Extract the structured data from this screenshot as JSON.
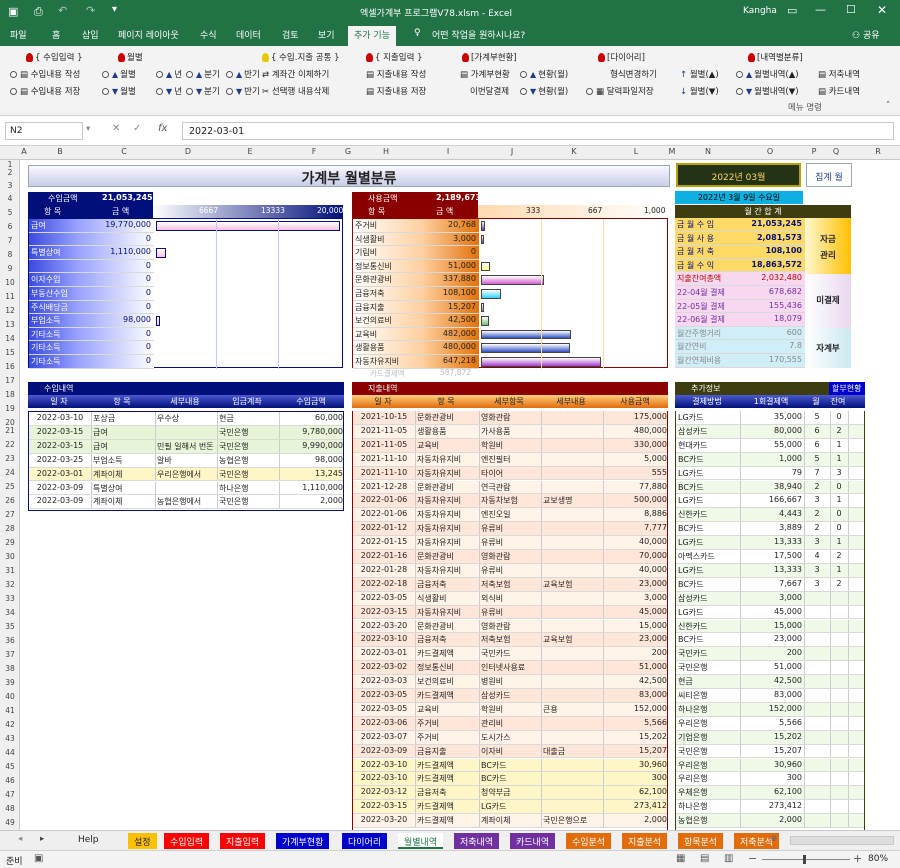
{
  "window": {
    "title": "엑셀가계부 프로그램V78.xlsm  -  Excel",
    "user": "Kangha"
  },
  "ribbon_tabs": [
    "파일",
    "홈",
    "삽입",
    "페이지 레이아웃",
    "수식",
    "데이터",
    "검토",
    "보기",
    "추가 기능"
  ],
  "tell_me": "어떤 작업을 원하시나요?",
  "share": "공유",
  "ribbon": {
    "g1_title": "{ 수입입력 }",
    "g1_a": "수입내용 작성",
    "g1_b": "수입내용 저장",
    "g2_title": "월별",
    "g2_items": [
      "월별",
      "년",
      "분기",
      "반기",
      "월별",
      "년",
      "분기",
      "반기"
    ],
    "g3_title": "{ 수입.지출 공통 }",
    "g3_a": "계좌간 이체하기",
    "g3_b": "선택행 내용삭제",
    "g4_title": "{ 지출입력 }",
    "g4_a": "지출내용 작성",
    "g4_b": "지출내용 저장",
    "g5_title": "[가계부현황]",
    "g5_a": "가계부현황",
    "g5_b": "이번달결제",
    "g5_c": "현황(월)",
    "g5_d": "현황(월)",
    "g6_title": "[다이어리]",
    "g6_a": "형식변경하기",
    "g6_b": "달력파일저장",
    "g7_title": "[내역별분류]",
    "g7_a": "월별(▲)",
    "g7_b": "월별(▼)",
    "g7_c": "월별내역(▲)",
    "g7_d": "월별내역(▼)",
    "g8_a": "저축내역",
    "g8_b": "카드내역",
    "menu_label": "메뉴 명령"
  },
  "formula": {
    "namebox": "N2",
    "value": "2022-03-01"
  },
  "columns": [
    "A",
    "B",
    "C",
    "D",
    "E",
    "F",
    "G",
    "H",
    "I",
    "J",
    "K",
    "L",
    "M",
    "N",
    "O",
    "P",
    "Q",
    "R"
  ],
  "rows": [
    "1",
    "2",
    "3",
    "4",
    "5",
    "6",
    "7",
    "8",
    "9",
    "10",
    "11",
    "12",
    "13",
    "14",
    "15",
    "16",
    "17",
    "18",
    "19",
    "20",
    "21",
    "22",
    "23",
    "24",
    "25",
    "26",
    "27",
    "28",
    "29",
    "30",
    "31",
    "32",
    "33",
    "34",
    "35",
    "36",
    "37",
    "38",
    "39",
    "40",
    "41",
    "42",
    "43",
    "44",
    "45",
    "46",
    "47",
    "48",
    "49",
    "50"
  ],
  "title": "가계부 월별분류",
  "month_box": "2022년 03월",
  "sum_button": "집계 월",
  "today": "2022년 3월 9일 수요일",
  "income": {
    "label": "수입금액",
    "total": "21,053,245",
    "col_item": "항 목",
    "col_amt": "금 액",
    "scale": [
      "6667",
      "13333",
      "20,000"
    ],
    "rows": [
      {
        "name": "급여",
        "amt": "19,770,000",
        "frac": 0.989
      },
      {
        "name": "",
        "amt": "0",
        "frac": 0
      },
      {
        "name": "특별상여",
        "amt": "1,110,000",
        "frac": 0.056
      },
      {
        "name": "",
        "amt": "0",
        "frac": 0
      },
      {
        "name": "이자수입",
        "amt": "0",
        "frac": 0
      },
      {
        "name": "부동산수입",
        "amt": "0",
        "frac": 0
      },
      {
        "name": "주식배당금",
        "amt": "0",
        "frac": 0
      },
      {
        "name": "부업소득",
        "amt": "98,000",
        "frac": 0.005
      },
      {
        "name": "기타소득",
        "amt": "0",
        "frac": 0
      },
      {
        "name": "기타소득",
        "amt": "0",
        "frac": 0
      },
      {
        "name": "기타소득",
        "amt": "0",
        "frac": 0
      }
    ]
  },
  "expense": {
    "label": "사용금액",
    "total": "2,189,673",
    "col_item": "항 목",
    "col_amt": "금 액",
    "scale": [
      "333",
      "667",
      "1,000"
    ],
    "rows": [
      {
        "name": "주거비",
        "amt": "20,768",
        "frac": 0.021
      },
      {
        "name": "식생활비",
        "amt": "3,000",
        "frac": 0.003
      },
      {
        "name": "기림비",
        "amt": "0",
        "frac": 0
      },
      {
        "name": "정보통신비",
        "amt": "51,000",
        "frac": 0.051
      },
      {
        "name": "문화관광비",
        "amt": "337,880",
        "frac": 0.338
      },
      {
        "name": "금융저축",
        "amt": "108,100",
        "frac": 0.108
      },
      {
        "name": "금융지출",
        "amt": "15,207",
        "frac": 0.015
      },
      {
        "name": "보건의료비",
        "amt": "42,500",
        "frac": 0.043
      },
      {
        "name": "교육비",
        "amt": "482,000",
        "frac": 0.482
      },
      {
        "name": "생활용품",
        "amt": "480,000",
        "frac": 0.48
      },
      {
        "name": "자동차유지비",
        "amt": "647,218",
        "frac": 0.647
      }
    ],
    "card_row": {
      "name": "카드결제액",
      "amt": "587,872"
    }
  },
  "monthly": {
    "title": "월 간 합 계",
    "rows": [
      {
        "k": "금 월 수 입",
        "v": "21,053,245"
      },
      {
        "k": "금 월 사 용",
        "v": "2,081,573"
      },
      {
        "k": "금 월 저 축",
        "v": "108,100"
      },
      {
        "k": "금 월 수 익",
        "v": "18,863,572"
      },
      {
        "k": "지출잔여총액",
        "v": "2,032,480"
      },
      {
        "k": "22-04월 결제",
        "v": "678,682"
      },
      {
        "k": "22-05월 결제",
        "v": "155,436"
      },
      {
        "k": "22-06월 결제",
        "v": "18,079"
      },
      {
        "k": "월간주행거리",
        "v": "600"
      },
      {
        "k": "월간연비",
        "v": "7.8"
      },
      {
        "k": "월간연체비용",
        "v": "170,555"
      }
    ],
    "side": [
      "자금",
      "관리",
      "미결제",
      "자계부"
    ]
  },
  "income_list": {
    "title": "수입내역",
    "cols": [
      "일 자",
      "항 목",
      "세부내용",
      "입금계좌",
      "수입금액"
    ],
    "rows": [
      [
        "2022-03-10",
        "포상금",
        "우수상",
        "현금",
        "60,000"
      ],
      [
        "2022-03-15",
        "급여",
        "",
        "국민은행",
        "9,780,000"
      ],
      [
        "2022-03-15",
        "급여",
        "민필 일해서 번돈",
        "국민은행",
        "9,990,000"
      ],
      [
        "2022-03-25",
        "부업소득",
        "알바",
        "농협은행",
        "98,000"
      ],
      [
        "2022-03-01",
        "계좌이체",
        "우리은행에서",
        "국민은행",
        "13,245"
      ],
      [
        "2022-03-09",
        "특별상여",
        "",
        "하나은행",
        "1,110,000"
      ],
      [
        "2022-03-09",
        "계좌이체",
        "농협은행에서",
        "국민은행",
        "2,000"
      ]
    ]
  },
  "expense_list": {
    "title": "지출내역",
    "cols": [
      "일 자",
      "항 목",
      "세부항목",
      "세부내용",
      "사용금액"
    ],
    "rows": [
      [
        "2021-10-15",
        "문화관광비",
        "영화관람",
        "",
        "175,000"
      ],
      [
        "2021-11-05",
        "생활용품",
        "가사용품",
        "",
        "480,000"
      ],
      [
        "2021-11-05",
        "교육비",
        "학원비",
        "",
        "330,000"
      ],
      [
        "2021-11-10",
        "자동차유지비",
        "엔진필터",
        "",
        "5,000"
      ],
      [
        "2021-11-10",
        "자동차유지비",
        "타이어",
        "",
        "555"
      ],
      [
        "2021-12-28",
        "문화관광비",
        "연극관람",
        "",
        "77,880"
      ],
      [
        "2022-01-06",
        "자동차유지비",
        "자동차보험",
        "교보생명",
        "500,000"
      ],
      [
        "2022-01-06",
        "자동차유지비",
        "엔진오일",
        "",
        "8,886"
      ],
      [
        "2022-01-12",
        "자동차유지비",
        "유류비",
        "",
        "7,777"
      ],
      [
        "2022-01-15",
        "자동차유지비",
        "유류비",
        "",
        "40,000"
      ],
      [
        "2022-01-16",
        "문화관광비",
        "영화관람",
        "",
        "70,000"
      ],
      [
        "2022-01-28",
        "자동차유지비",
        "유류비",
        "",
        "40,000"
      ],
      [
        "2022-02-18",
        "금융저축",
        "저축보험",
        "교육보험",
        "23,000"
      ],
      [
        "2022-03-05",
        "식생활비",
        "외식비",
        "",
        "3,000"
      ],
      [
        "2022-03-15",
        "자동차유지비",
        "유류비",
        "",
        "45,000"
      ],
      [
        "2022-03-20",
        "문화관광비",
        "영화관람",
        "",
        "15,000"
      ],
      [
        "2022-03-10",
        "금융저축",
        "저축보험",
        "교육보험",
        "23,000"
      ],
      [
        "2022-03-01",
        "카드결제액",
        "국민카드",
        "",
        "200"
      ],
      [
        "2022-03-02",
        "정보통신비",
        "인터넷사용료",
        "",
        "51,000"
      ],
      [
        "2022-03-03",
        "보건의료비",
        "병원비",
        "",
        "42,500"
      ],
      [
        "2022-03-05",
        "카드결제액",
        "삼성카드",
        "",
        "83,000"
      ],
      [
        "2022-03-05",
        "교육비",
        "학원비",
        "큰용",
        "152,000"
      ],
      [
        "2022-03-06",
        "주거비",
        "관리비",
        "",
        "5,566"
      ],
      [
        "2022-03-07",
        "주거비",
        "도시가스",
        "",
        "15,202"
      ],
      [
        "2022-03-09",
        "금융지출",
        "이자비",
        "대출금",
        "15,207"
      ],
      [
        "2022-03-10",
        "카드결제액",
        "BC카드",
        "",
        "30,960"
      ],
      [
        "2022-03-10",
        "카드결제액",
        "BC카드",
        "",
        "300"
      ],
      [
        "2022-03-12",
        "금융저축",
        "청약부금",
        "",
        "62,100"
      ],
      [
        "2022-03-15",
        "카드결제액",
        "LG카드",
        "",
        "273,412"
      ],
      [
        "2022-03-20",
        "카드결제액",
        "계좌이체",
        "국민은행으로",
        "2,000"
      ]
    ]
  },
  "extra": {
    "title": "추가정보",
    "title2": "할부현황",
    "cols": [
      "결제방법",
      "1회결제액",
      "월",
      "잔여"
    ],
    "rows": [
      [
        "LG카드",
        "35,000",
        "5",
        "0"
      ],
      [
        "삼성카드",
        "80,000",
        "6",
        "2"
      ],
      [
        "현대카드",
        "55,000",
        "6",
        "1"
      ],
      [
        "BC카드",
        "1,000",
        "5",
        "1"
      ],
      [
        "LG카드",
        "79",
        "7",
        "3"
      ],
      [
        "BC카드",
        "38,940",
        "2",
        "0"
      ],
      [
        "LG카드",
        "166,667",
        "3",
        "1"
      ],
      [
        "신한카드",
        "4,443",
        "2",
        "0"
      ],
      [
        "BC카드",
        "3,889",
        "2",
        "0"
      ],
      [
        "LG카드",
        "13,333",
        "3",
        "1"
      ],
      [
        "아멕스카드",
        "17,500",
        "4",
        "2"
      ],
      [
        "LG카드",
        "13,333",
        "3",
        "1"
      ],
      [
        "BC카드",
        "7,667",
        "3",
        "2"
      ],
      [
        "삼성카드",
        "3,000",
        "",
        ""
      ],
      [
        "LG카드",
        "45,000",
        "",
        ""
      ],
      [
        "신한카드",
        "15,000",
        "",
        ""
      ],
      [
        "BC카드",
        "23,000",
        "",
        ""
      ],
      [
        "국민카드",
        "200",
        "",
        ""
      ],
      [
        "국민은행",
        "51,000",
        "",
        ""
      ],
      [
        "현금",
        "42,500",
        "",
        ""
      ],
      [
        "씨티은행",
        "83,000",
        "",
        ""
      ],
      [
        "하나은행",
        "152,000",
        "",
        ""
      ],
      [
        "우리은행",
        "5,566",
        "",
        ""
      ],
      [
        "기업은행",
        "15,202",
        "",
        ""
      ],
      [
        "국민은행",
        "15,207",
        "",
        ""
      ],
      [
        "우리은행",
        "30,960",
        "",
        ""
      ],
      [
        "우리은행",
        "300",
        "",
        ""
      ],
      [
        "우체은행",
        "62,100",
        "",
        ""
      ],
      [
        "하나은행",
        "273,412",
        "",
        ""
      ],
      [
        "농협은행",
        "2,000",
        "",
        ""
      ]
    ]
  },
  "sheet_tabs": [
    {
      "name": "Help",
      "color": "#efefef",
      "fg": "#222"
    },
    {
      "name": "설정",
      "color": "#ffc000",
      "fg": "#222"
    },
    {
      "name": "수입입력",
      "color": "#ff0000",
      "fg": "#fff"
    },
    {
      "name": "지출입력",
      "color": "#ff0000",
      "fg": "#fff"
    },
    {
      "name": "가계부현황",
      "color": "#0000cc",
      "fg": "#fff"
    },
    {
      "name": "다이어리",
      "color": "#0000cc",
      "fg": "#fff"
    },
    {
      "name": "월별내역",
      "color": "#ffffff",
      "fg": "#217346"
    },
    {
      "name": "저축내역",
      "color": "#7030a0",
      "fg": "#fff"
    },
    {
      "name": "카드내역",
      "color": "#7030a0",
      "fg": "#fff"
    },
    {
      "name": "수입분석",
      "color": "#e26b0a",
      "fg": "#fff"
    },
    {
      "name": "지출분석",
      "color": "#e26b0a",
      "fg": "#fff"
    },
    {
      "name": "항목분석",
      "color": "#e26b0a",
      "fg": "#fff"
    },
    {
      "name": "저축분석",
      "color": "#e26b0a",
      "fg": "#fff"
    }
  ],
  "status": {
    "ready": "준비",
    "zoom": "80%"
  }
}
